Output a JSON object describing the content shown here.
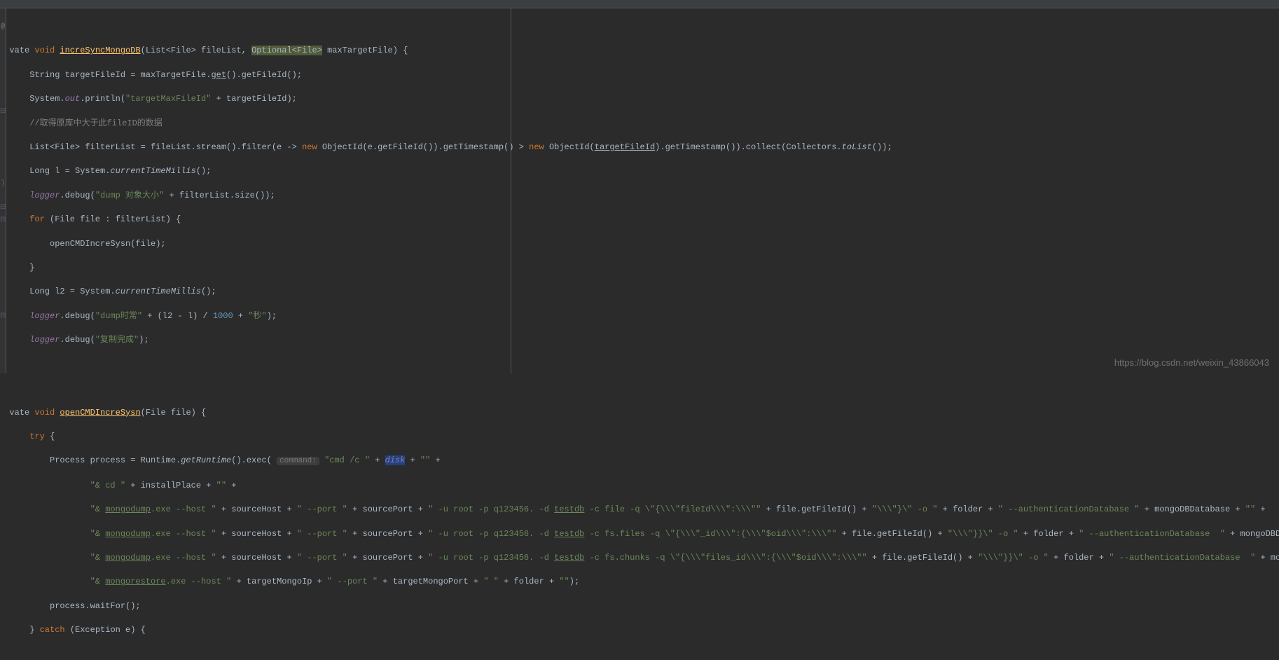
{
  "gutter": {
    "at_symbol": "@",
    "fold_close": "}"
  },
  "code": {
    "l1_p1": "vate ",
    "l1_void": "void ",
    "l1_method": "increSyncMongoDB",
    "l1_p2": "(List<File> fileList, ",
    "l1_optional": "Optional<File>",
    "l1_p3": " maxTargetFile) {",
    "l2_p1": "    String targetFileId = maxTargetFile.",
    "l2_get": "get",
    "l2_p2": "().getFileId();",
    "l3_p1": "    System.",
    "l3_out": "out",
    "l3_p2": ".println(",
    "l3_str": "\"targetMaxFileId\"",
    "l3_p3": " + targetFileId);",
    "l4_com": "    //取得原库中大于此fileID的数据",
    "l5_p1": "    List<File> filterList = fileList.stream().filter(e -> ",
    "l5_new1": "new ",
    "l5_p2": "ObjectId(e.getFileId()).getTimestamp() > ",
    "l5_new2": "new ",
    "l5_p3": "ObjectId(",
    "l5_tfi": "targetFileId",
    "l5_p4": ").getTimestamp()).collect(Collectors.",
    "l5_tolist": "toList",
    "l5_p5": "());",
    "l6_p1": "    Long l = System.",
    "l6_ctm": "currentTimeMillis",
    "l6_p2": "();",
    "l7_p1": "    ",
    "l7_logger": "logger",
    "l7_p2": ".debug(",
    "l7_str": "\"dump 对象大小\"",
    "l7_p3": " + filterList.size());",
    "l8_for": "    for ",
    "l8_p1": "(File file : filterList) {",
    "l9": "        openCMDIncreSysn(file);",
    "l10": "    }",
    "l11_p1": "    Long l2 = System.",
    "l11_ctm": "currentTimeMillis",
    "l11_p2": "();",
    "l12_p1": "    ",
    "l12_logger": "logger",
    "l12_p2": ".debug(",
    "l12_str1": "\"dump时常\"",
    "l12_p3": " + (l2 - l) / ",
    "l12_num": "1000",
    "l12_p4": " + ",
    "l12_str2": "\"秒\"",
    "l12_p5": ");",
    "l13_p1": "    ",
    "l13_logger": "logger",
    "l13_p2": ".debug(",
    "l13_str": "\"复制完成\"",
    "l13_p3": ");",
    "l15_p1": "vate ",
    "l15_void": "void ",
    "l15_method": "openCMDIncreSysn",
    "l15_p2": "(File file) {",
    "l16_try": "    try ",
    "l16_p1": "{",
    "l17_p1": "        Process process = Runtime.",
    "l17_gr": "getRuntime",
    "l17_p2": "().exec( ",
    "l17_hint": "command:",
    "l17_space": " ",
    "l17_str1": "\"cmd /c \"",
    "l17_p3": " + ",
    "l17_disk": "disk",
    "l17_p4": " + ",
    "l17_str2": "\"\"",
    "l17_p5": " +",
    "l18_str": "                \"& cd \"",
    "l18_p1": " + installPlace + ",
    "l18_str2": "\"\"",
    "l18_p2": " +",
    "l19_p1": "                ",
    "l19_str1": "\"& ",
    "l19_mongo": "mongodump",
    "l19_str2": ".exe --host \"",
    "l19_p2": " + sourceHost + ",
    "l19_str3": "\" --port \"",
    "l19_p3": " + sourcePort + ",
    "l19_str4": "\" -u root -p q123456. -d ",
    "l19_testdb": "testdb",
    "l19_str5": " -c file -q \\\"{\\\\\\\"fileId\\\\\\\":\\\\\\\"\"",
    "l19_p4": " + file.getFileId() + ",
    "l19_str6": "\"\\\\\\\"}\\\" -o \"",
    "l19_p5": " + folder + ",
    "l19_str7": "\" --authenticationDatabase \"",
    "l19_p6": " + mongoDBDatabase + ",
    "l19_str8": "\"\"",
    "l19_p7": " +",
    "l20_p1": "                ",
    "l20_str1": "\"& ",
    "l20_mongo": "mongodump",
    "l20_str2": ".exe --host \"",
    "l20_p2": " + sourceHost + ",
    "l20_str3": "\" --port \"",
    "l20_p3": " + sourcePort + ",
    "l20_str4": "\" -u root -p q123456. -d ",
    "l20_testdb": "testdb",
    "l20_str5": " -c fs.files -q \\\"{\\\\\\\"_id\\\\\\\":{\\\\\\\"$oid\\\\\\\":\\\\\\\"\"",
    "l20_p4": " + file.getFileId() + ",
    "l20_str6": "\"\\\\\\\"}}\\\" -o \"",
    "l20_p5": " + folder + ",
    "l20_str7": "\" --authenticationDatabase  \"",
    "l20_p6": " + mongoDBData",
    "l21_p1": "                ",
    "l21_str1": "\"& ",
    "l21_mongo": "mongodump",
    "l21_str2": ".exe --host \"",
    "l21_p2": " + sourceHost + ",
    "l21_str3": "\" --port \"",
    "l21_p3": " + sourcePort + ",
    "l21_str4": "\" -u root -p q123456. -d ",
    "l21_testdb": "testdb",
    "l21_str5": " -c fs.chunks -q \\\"{\\\\\\\"files_id\\\\\\\":{\\\\\\\"$oid\\\\\\\":\\\\\\\"\"",
    "l21_p4": " + file.getFileId() + ",
    "l21_str6": "\"\\\\\\\"}}\\\" -o \"",
    "l21_p5": " + folder + ",
    "l21_str7": "\" --authenticationDatabase  \"",
    "l21_p6": " + mongo",
    "l22_p1": "                ",
    "l22_str1": "\"& ",
    "l22_mongo": "mongorestore",
    "l22_str2": ".exe --host \"",
    "l22_p2": " + targetMongoIp + ",
    "l22_str3": "\" --port \"",
    "l22_p3": " + targetMongoPort + ",
    "l22_str4": "\" \"",
    "l22_p4": " + folder + ",
    "l22_str5": "\"\"",
    "l22_p5": ");",
    "l23": "        process.waitFor();",
    "l24_p1": "    } ",
    "l24_catch": "catch ",
    "l24_p2": "(Exception e) {"
  },
  "watermark": "https://blog.csdn.net/weixin_43866043"
}
